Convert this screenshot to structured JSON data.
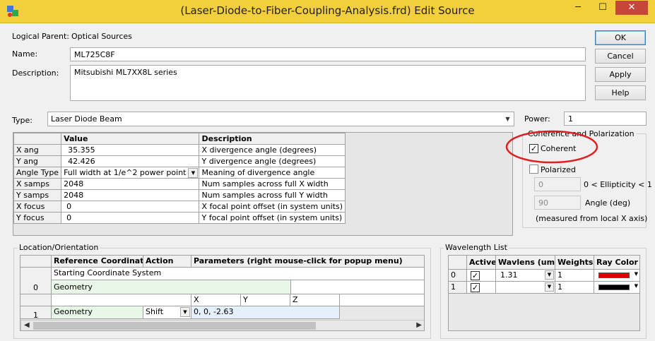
{
  "window": {
    "title": "(Laser-Diode-to-Fiber-Coupling-Analysis.frd) Edit Source",
    "min": "─",
    "max": "☐",
    "close": "✕"
  },
  "form": {
    "logical_parent_label": "Logical Parent:",
    "logical_parent_value": "Optical Sources",
    "name_label": "Name:",
    "name_value": "ML725C8F",
    "description_label": "Description:",
    "description_value": "Mitsubishi ML7XX8L series",
    "type_label": "Type:",
    "type_value": "Laser Diode Beam",
    "power_label": "Power:",
    "power_value": "1"
  },
  "buttons": {
    "ok": "OK",
    "cancel": "Cancel",
    "apply": "Apply",
    "help": "Help"
  },
  "params_table": {
    "headers": [
      "",
      "Value",
      "Description"
    ],
    "rows": [
      [
        "X ang",
        "35.355",
        "X divergence angle (degrees)"
      ],
      [
        "Y ang",
        "42.426",
        "Y divergence angle (degrees)"
      ],
      [
        "Angle Type",
        "Full width at 1/e^2 power point",
        "Meaning of divergence angle"
      ],
      [
        "X samps",
        "2048",
        "Num samples across full X width"
      ],
      [
        "Y samps",
        "2048",
        "Num samples across full Y width"
      ],
      [
        "X focus",
        "0",
        "X focal point offset (in system units)"
      ],
      [
        "Y focus",
        "0",
        "Y focal point offset (in system units)"
      ]
    ]
  },
  "coherence": {
    "group_label": "Coherence and Polarization",
    "coherent_label": "Coherent",
    "coherent_checked": "✓",
    "polarized_label": "Polarized",
    "ellipticity_value": "0",
    "ellipticity_label": "0 < Ellipticity < 1",
    "angle_value": "90",
    "angle_label": "Angle (deg)",
    "angle_note": "(measured from local X axis)",
    "highlight_color": "#e02020"
  },
  "location": {
    "group_label": "Location/Orientation",
    "headers": [
      "Reference Coordinate",
      "Action",
      "Parameters (right mouse-click for popup menu)"
    ],
    "row0_number": "0",
    "row0_ref_top": "Starting Coordinate System",
    "row0_ref": "Geometry",
    "xyz": [
      "X",
      "Y",
      "Z"
    ],
    "row1_number": "1",
    "row1_ref": "Geometry",
    "row1_action": "Shift",
    "row1_params": "0,  0,  -2.63"
  },
  "wavelength": {
    "group_label": "Wavelength List",
    "headers": [
      "Active",
      "Wavlens (um)",
      "Weights",
      "Ray Color"
    ],
    "rows": [
      {
        "index": "0",
        "active": "✓",
        "wavlen": "1.31",
        "weight": "1",
        "color": "#e00000"
      },
      {
        "index": "1",
        "active": "✓",
        "wavlen": "",
        "weight": "1",
        "color": "#000000"
      }
    ]
  },
  "colors": {
    "titlebar": "#f3cf3e",
    "geometry_cell": "#e8f7e8",
    "params_cell": "#e6f0fb"
  }
}
